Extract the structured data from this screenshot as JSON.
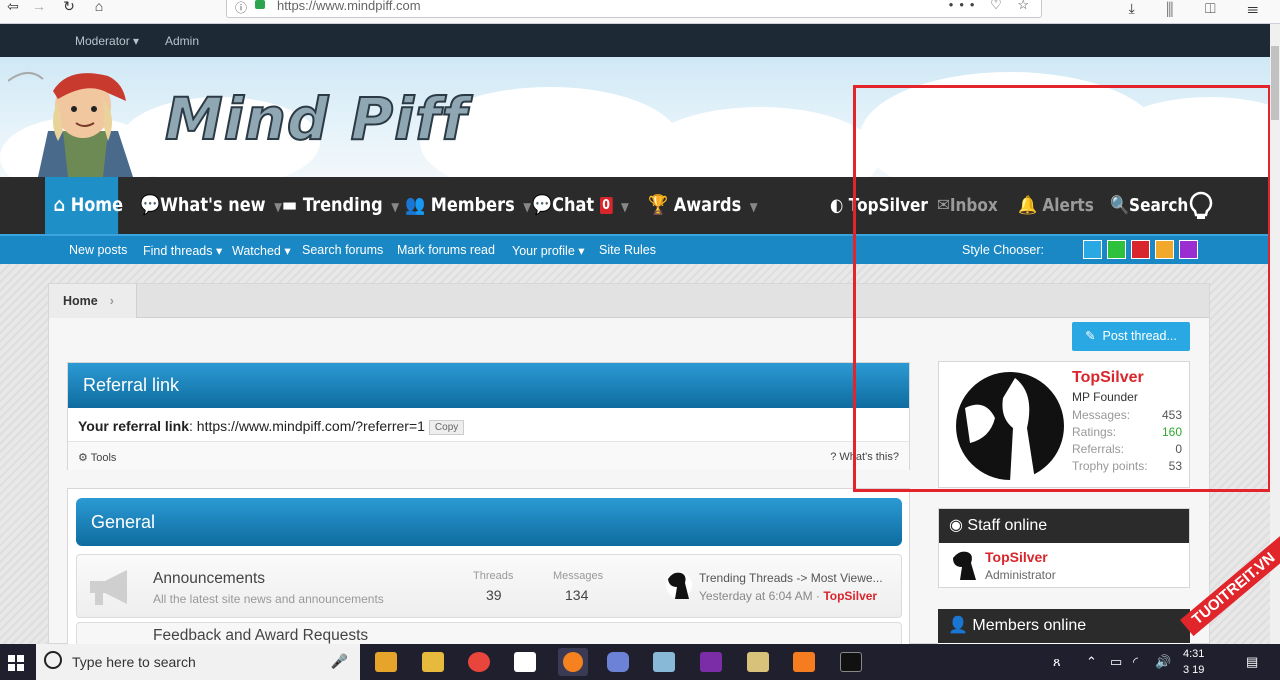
{
  "browser": {
    "url": "https://www.mindpiff.com",
    "info_icon": "info-icon",
    "menu_dots": "•••"
  },
  "admin_bar": {
    "moderator": "Moderator ▾",
    "admin": "Admin"
  },
  "header": {
    "logo_text": "Mind Piff"
  },
  "nav": {
    "home": "Home",
    "whats_new": "What's new",
    "trending": "Trending",
    "members": "Members",
    "chat": "Chat",
    "chat_count": "0",
    "awards": "Awards",
    "user": "TopSilver",
    "inbox": "Inbox",
    "alerts": "Alerts",
    "search": "Search"
  },
  "subnav": {
    "items": [
      "New posts",
      "Find threads ▾",
      "Watched ▾",
      "Search forums",
      "Mark forums read",
      "Your profile ▾",
      "Site Rules"
    ],
    "style_chooser_label": "Style Chooser:",
    "style_colors": [
      "#2aa8e3",
      "#2ec13c",
      "#d8262c",
      "#f0a92a",
      "#9a2ed0"
    ]
  },
  "breadcrumb": {
    "home": "Home"
  },
  "post_thread_label": "Post thread...",
  "referral": {
    "title": "Referral link",
    "label": "Your referral link",
    "link": ": https://www.mindpiff.com/?referrer=1",
    "copy": "Copy",
    "tools": "Tools",
    "whats_this": "What's this?"
  },
  "general": {
    "title": "General",
    "forums": [
      {
        "name": "Announcements",
        "description": "All the latest site news and announcements",
        "threads_label": "Threads",
        "threads": "39",
        "messages_label": "Messages",
        "messages": "134",
        "latest_title": "Trending Threads -> Most Viewe...",
        "latest_time": "Yesterday at 6:04 AM",
        "latest_user": "TopSilver"
      },
      {
        "name": "Feedback and Award Requests"
      }
    ]
  },
  "profile": {
    "name": "TopSilver",
    "title": "MP Founder",
    "stats": [
      {
        "label": "Messages:",
        "value": "453"
      },
      {
        "label": "Ratings:",
        "value": "160"
      },
      {
        "label": "Referrals:",
        "value": "0"
      },
      {
        "label": "Trophy points:",
        "value": "53"
      }
    ],
    "ratings_color": "#2ea62e"
  },
  "staff_online": {
    "title": "Staff online",
    "user": "TopSilver",
    "role": "Administrator"
  },
  "members_online": {
    "title": "Members online"
  },
  "taskbar": {
    "search_placeholder": "Type here to search",
    "time": "4:31",
    "date": "3 19"
  },
  "watermark": "TUOITREIT.VN"
}
